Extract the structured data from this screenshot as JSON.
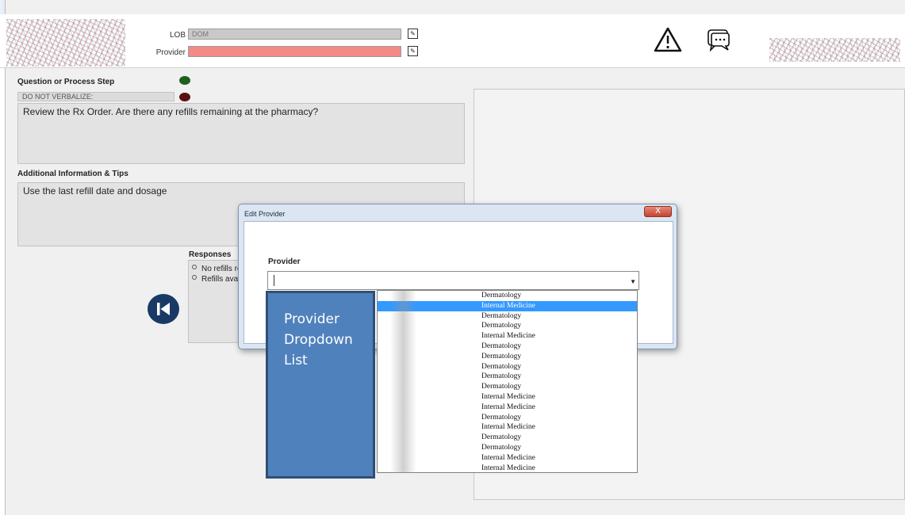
{
  "header": {
    "lob_label": "LOB",
    "lob_value": "DOM",
    "provider_label": "Provider",
    "provider_value": "",
    "provider_field_color": "#f28b84",
    "lob_field_color": "#c9c9c9"
  },
  "main": {
    "question_heading": "Question or Process Step",
    "do_not_verbalize": "DO NOT VERBALIZE:",
    "question_text": "Review the Rx Order. Are there any refills remaining at the pharmacy?",
    "additional_heading": "Additional Information & Tips",
    "additional_text": "Use the last refill date and dosage",
    "responses_heading": "Responses",
    "responses": [
      "No refills remaining",
      "Refills available"
    ],
    "status_colors": [
      "#1f5f1f",
      "#5a1010"
    ]
  },
  "dialog": {
    "title": "Edit Provider",
    "close_label": "X",
    "field_label": "Provider",
    "input_value": "",
    "options": [
      "Dermatology",
      "Internal Medicine",
      "Dermatology",
      "Dermatology",
      "Internal Medicine",
      "Dermatology",
      "Dermatology",
      "Dermatology",
      "Dermatology",
      "Dermatology",
      "Internal Medicine",
      "Internal Medicine",
      "Dermatology",
      "Internal Medicine",
      "Dermatology",
      "Dermatology",
      "Internal Medicine",
      "Internal Medicine"
    ],
    "selected_index": 1
  },
  "callout": {
    "text": "Provider Dropdown List",
    "color": "#4f81bd"
  },
  "icons": {
    "warning": "warning-triangle-icon",
    "chat": "chat-bubble-icon",
    "back": "skip-back-icon"
  }
}
